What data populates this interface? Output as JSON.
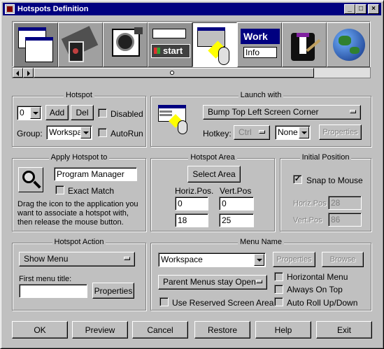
{
  "window": {
    "title": "Hotspots Definition",
    "min_icon": "minimize-icon",
    "max_icon": "maximize-icon",
    "close_icon": "close-icon"
  },
  "thumbnails": [
    "windows-menu-icon",
    "film-reel-icon",
    "camera-icon",
    "start-button-icon",
    "hotspot-corner-icon",
    "info-window-icon",
    "tuxedo-icon",
    "globe-icon"
  ],
  "thumb_text": {
    "start": "start",
    "work": "Work",
    "info": "Info"
  },
  "hotspot": {
    "caption": "Hotspot",
    "number": "0",
    "add": "Add",
    "del": "Del",
    "disabled": "Disabled",
    "group_label": "Group:",
    "group_value": "Workspac",
    "autorun": "AutoRun"
  },
  "launch": {
    "caption": "Launch with",
    "selection": "Bump Top Left Screen Corner",
    "hotkey_label": "Hotkey:",
    "hotkey_mod": "Ctrl",
    "hotkey_key": "None",
    "properties": "Properties"
  },
  "apply": {
    "caption": "Apply Hotspot to",
    "app": "Program Manager",
    "exact": "Exact Match",
    "hint": "Drag the icon to the application you want to associate a hotspot with, then release the mouse button."
  },
  "area": {
    "caption": "Hotspot Area",
    "select": "Select Area",
    "hpos_label": "Horiz.Pos.",
    "vpos_label": "Vert.Pos",
    "h1": "0",
    "v1": "0",
    "h2": "18",
    "v2": "25"
  },
  "initial": {
    "caption": "Initial Position",
    "snap": "Snap to Mouse",
    "hpos_label": "Horiz.Pos",
    "vpos_label": "Vert.Pos",
    "hpos": "28",
    "vpos": "86"
  },
  "action": {
    "caption": "Hotspot Action",
    "selection": "Show Menu",
    "first_title": "First menu title:",
    "first_value": "",
    "properties": "Properties"
  },
  "menu": {
    "caption": "Menu Name",
    "name": "Workspace",
    "properties": "Properties",
    "browse": "Browse",
    "parent": "Parent Menus stay Open",
    "horizontal": "Horizontal Menu",
    "ontop": "Always On Top",
    "reserved": "Use Reserved Screen Area",
    "autoroll": "Auto Roll Up/Down"
  },
  "buttons": {
    "ok": "OK",
    "preview": "Preview",
    "cancel": "Cancel",
    "restore": "Restore",
    "help": "Help",
    "exit": "Exit"
  }
}
